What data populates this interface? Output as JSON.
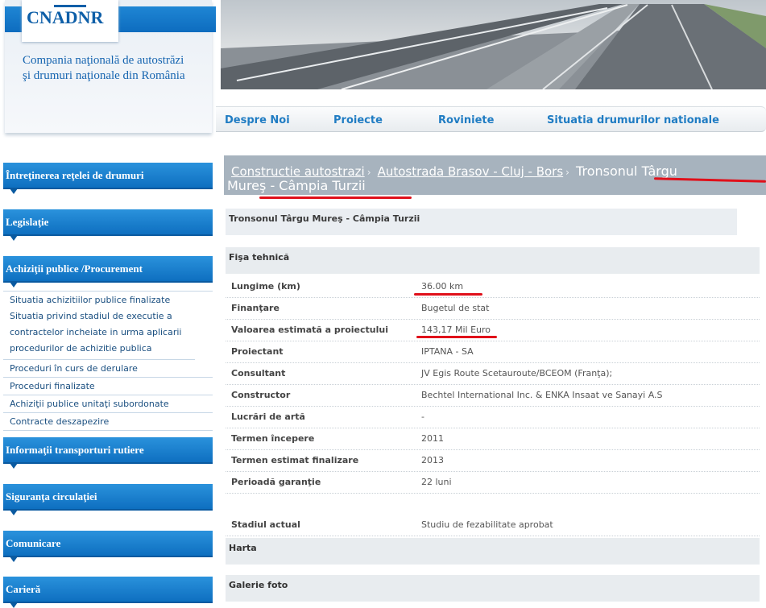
{
  "brand": {
    "logo": "CNADNR",
    "tagline_line1": "Compania naţională de autostrăzi",
    "tagline_line2": "şi drumuri naţionale din România"
  },
  "topnav": [
    "Despre Noi",
    "Proiecte",
    "Roviniete",
    "Situatia drumurilor nationale"
  ],
  "sidebar": {
    "sections": [
      "Întreţinerea reţelei de drumuri",
      "Legislaţie",
      "Achiziţii publice /Procurement",
      "Informaţii transporturi rutiere",
      "Siguranţa circulaţiei",
      "Comunicare",
      "Carieră"
    ],
    "procurement_items": [
      "Situatia achizitiilor publice finalizate",
      "Situatia privind stadiul de executie a contractelor incheiate in urma aplicarii procedurilor de achizitie publica",
      "Proceduri în curs de derulare",
      "Proceduri finalizate",
      "Achiziţii publice unitaţi subordonate",
      "Contracte deszapezire"
    ]
  },
  "breadcrumb": {
    "link1": "Constructie autostrazi",
    "link2": "Autostrada Brasov - Cluj - Bors",
    "current_line1": "Tronsonul Târgu",
    "current_line2": "Mureş - Câmpia Turzii"
  },
  "page_title": "Tronsonul Târgu Mureş - Câmpia Turzii",
  "section_tech": "Fişa tehnică",
  "specs": [
    {
      "label": "Lungime (km)",
      "value": "36.00 km"
    },
    {
      "label": "Finanţare",
      "value": "Bugetul de stat"
    },
    {
      "label": "Valoarea estimată a proiectului",
      "value": "143,17 Mil Euro"
    },
    {
      "label": "Proiectant",
      "value": "IPTANA - SA"
    },
    {
      "label": "Consultant",
      "value": "JV Egis Route Scetauroute/BCEOM (Franţa);"
    },
    {
      "label": "Constructor",
      "value": "Bechtel International Inc. & ENKA Insaat ve Sanayi A.S"
    },
    {
      "label": "Lucrări de artă",
      "value": "-"
    },
    {
      "label": "Termen începere",
      "value": "2011"
    },
    {
      "label": "Termen estimat finalizare",
      "value": "2013"
    },
    {
      "label": "Perioadă garanţie",
      "value": "22 luni"
    }
  ],
  "status": {
    "label": "Stadiul actual",
    "value": "Studiu de fezabilitate aprobat"
  },
  "section_map": "Harta",
  "section_gallery": "Galerie foto",
  "colors": {
    "brand_blue": "#0e6fc0",
    "annotation_red": "#e0101a",
    "crumb_bg": "#a7b3be"
  }
}
